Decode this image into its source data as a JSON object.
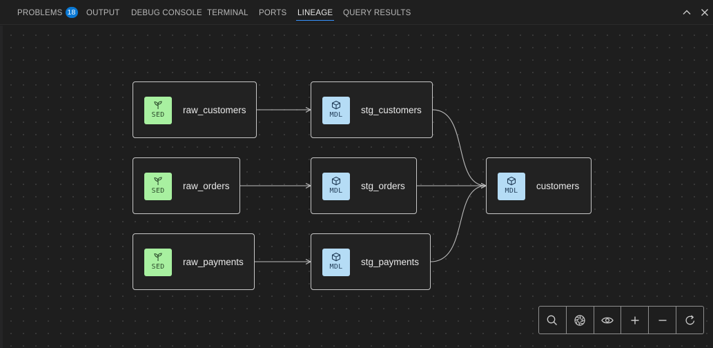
{
  "panel": {
    "tabs": [
      {
        "label": "PROBLEMS",
        "badge": "18"
      },
      {
        "label": "OUTPUT"
      },
      {
        "label": "DEBUG CONSOLE"
      },
      {
        "label": "TERMINAL"
      },
      {
        "label": "PORTS"
      },
      {
        "label": "LINEAGE",
        "active": true
      },
      {
        "label": "QUERY RESULTS"
      }
    ],
    "window_icons": [
      "chevron-up-icon",
      "close-icon"
    ]
  },
  "lineage": {
    "nodes": {
      "raw_customers": {
        "name": "raw_customers",
        "kind": "SED"
      },
      "raw_orders": {
        "name": "raw_orders",
        "kind": "SED"
      },
      "raw_payments": {
        "name": "raw_payments",
        "kind": "SED"
      },
      "stg_customers": {
        "name": "stg_customers",
        "kind": "MDL"
      },
      "stg_orders": {
        "name": "stg_orders",
        "kind": "MDL"
      },
      "stg_payments": {
        "name": "stg_payments",
        "kind": "MDL"
      },
      "customers": {
        "name": "customers",
        "kind": "MDL"
      }
    },
    "edges": [
      [
        "raw_customers",
        "stg_customers"
      ],
      [
        "raw_orders",
        "stg_orders"
      ],
      [
        "raw_payments",
        "stg_payments"
      ],
      [
        "stg_customers",
        "customers"
      ],
      [
        "stg_orders",
        "customers"
      ],
      [
        "stg_payments",
        "customers"
      ]
    ],
    "colors": {
      "seed": "#a8f0a0",
      "model": "#b5dcf5",
      "edge": "#bdbdbd"
    }
  },
  "toolbar": {
    "tools": [
      "search-icon",
      "aperture-icon",
      "eye-icon",
      "plus-icon",
      "minus-icon",
      "refresh-icon"
    ]
  }
}
